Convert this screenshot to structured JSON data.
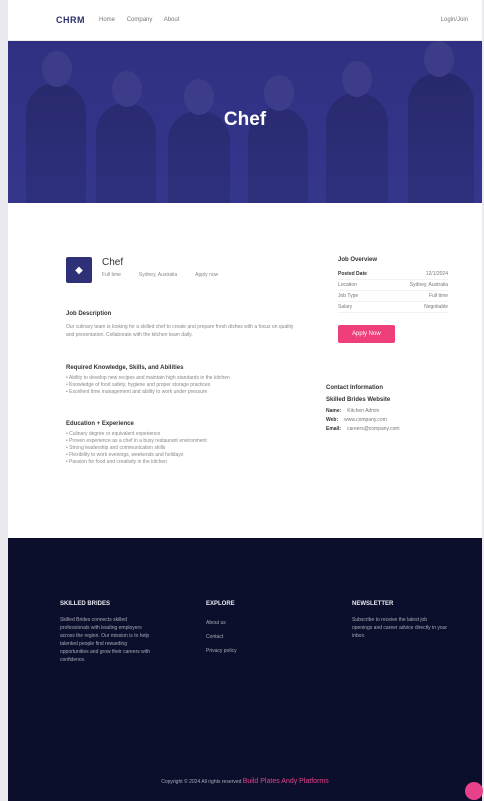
{
  "header": {
    "logo": "CHRM",
    "nav": [
      "Home",
      "Company",
      "About"
    ],
    "right_link": "Login/Join"
  },
  "hero": {
    "title": "Chef"
  },
  "job": {
    "logo_glyph": "◆",
    "title": "Chef",
    "subtitle_items": [
      "Full time",
      "Sydney, Australia",
      "Apply now"
    ],
    "description_title": "Job Description",
    "description": "Our culinary team is looking for a skilled chef to create and prepare fresh dishes with a focus on quality and presentation. Collaborate with the kitchen team daily.",
    "skills_title": "Required Knowledge, Skills, and Abilities",
    "skills": [
      "Ability to develop new recipes and maintain high standards in the kitchen",
      "Knowledge of food safety, hygiene and proper storage practices",
      "Excellent time management and ability to work under pressure"
    ],
    "competencies_title": "Education + Experience",
    "competencies": [
      "Culinary degree or equivalent experience",
      "Proven experience as a chef in a busy restaurant environment",
      "Strong leadership and communication skills",
      "Flexibility to work evenings, weekends and holidays",
      "Passion for food and creativity in the kitchen"
    ]
  },
  "overview": {
    "title": "Job Overview",
    "rows": [
      {
        "k": "Posted Date",
        "v": "12/1/2024"
      },
      {
        "k": "Location",
        "v": "Sydney, Australia"
      },
      {
        "k": "Job Type",
        "v": "Full time"
      },
      {
        "k": "Salary",
        "v": "Negotiable"
      }
    ],
    "apply_label": "Apply Now"
  },
  "contact": {
    "title": "Contact Information",
    "company": "Skilled Brides Website",
    "rows": [
      {
        "k": "Name:",
        "v": "Kitchen Admin"
      },
      {
        "k": "Web:",
        "v": "www.company.com"
      },
      {
        "k": "Email:",
        "v": "careers@company.com"
      }
    ]
  },
  "footer": {
    "col1_title": "SKILLED BRIDES",
    "col1_text": "Skilled Brides connects skilled professionals with leading employers across the region. Our mission is to help talented people find rewarding opportunities and grow their careers with confidence.",
    "col2_title": "EXPLORE",
    "col2_links": [
      "About us",
      "Contact",
      "Privacy policy"
    ],
    "col3_title": "NEWSLETTER",
    "col3_text": "Subscribe to receive the latest job openings and career advice directly in your inbox.",
    "copyright": "Copyright © 2024 All rights reserved",
    "brand": "Build Plates Andy Platforms"
  }
}
